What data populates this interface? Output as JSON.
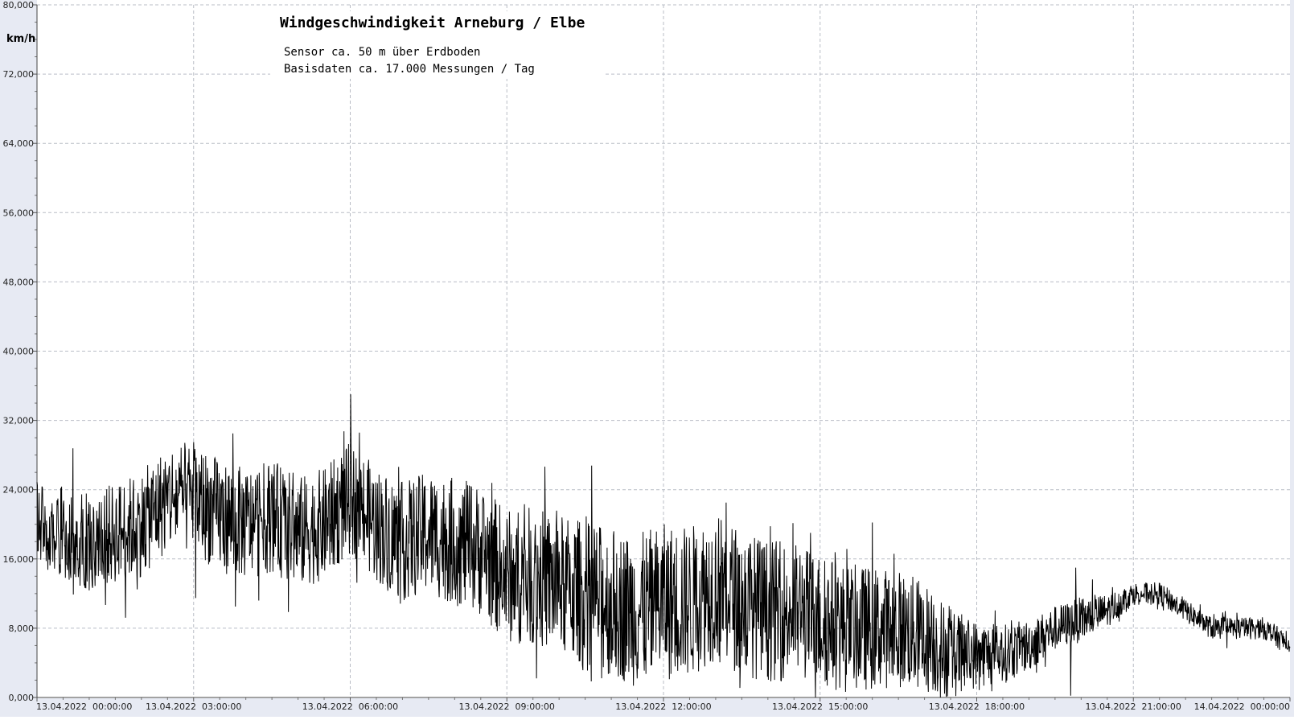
{
  "chart_data": {
    "type": "line",
    "title": "Windgeschwindigkeit  Arneburg / Elbe",
    "subtitle_lines": [
      "Sensor ca. 50 m über Erdboden",
      "Basisdaten ca. 17.000 Messungen / Tag"
    ],
    "ylabel": "km/h",
    "ylim": [
      0,
      80
    ],
    "yticks": [
      "0,000",
      "8,000",
      "16,000",
      "24,000",
      "32,000",
      "40,000",
      "48,000",
      "56,000",
      "64,000",
      "72,000",
      "80,000"
    ],
    "xlim_hours": [
      0,
      24
    ],
    "xticks": [
      {
        "hour": 0,
        "label": "13.04.2022  00:00:00"
      },
      {
        "hour": 3,
        "label": "13.04.2022  03:00:00"
      },
      {
        "hour": 6,
        "label": "13.04.2022  06:00:00"
      },
      {
        "hour": 9,
        "label": "13.04.2022  09:00:00"
      },
      {
        "hour": 12,
        "label": "13.04.2022  12:00:00"
      },
      {
        "hour": 15,
        "label": "13.04.2022  15:00:00"
      },
      {
        "hour": 18,
        "label": "13.04.2022  18:00:00"
      },
      {
        "hour": 21,
        "label": "13.04.2022  21:00:00"
      },
      {
        "hour": 24,
        "label": "14.04.2022  00:00:00"
      }
    ],
    "grid": true,
    "series": [
      {
        "color": "#000000",
        "mean_profile": {
          "hours": [
            0,
            0.5,
            1,
            1.5,
            2,
            2.5,
            3,
            3.5,
            4,
            4.5,
            5,
            5.5,
            6,
            6.5,
            7,
            7.5,
            8,
            8.5,
            9,
            9.5,
            10,
            10.5,
            11,
            11.5,
            12,
            12.5,
            13,
            13.5,
            14,
            14.5,
            15,
            15.5,
            16,
            16.5,
            17,
            17.5,
            18,
            18.5,
            19,
            19.5,
            20,
            20.5,
            21,
            21.5,
            22,
            22.5,
            23,
            23.5,
            24
          ],
          "values": [
            20,
            19,
            18,
            19,
            20,
            23,
            23,
            21,
            20,
            21,
            19,
            20,
            23,
            20,
            18,
            19,
            18,
            17,
            14,
            14,
            13,
            12,
            11,
            10,
            11,
            11,
            13,
            11,
            10,
            10,
            9,
            8,
            8,
            8,
            7,
            5,
            5,
            5,
            6,
            8,
            9,
            10,
            12,
            12,
            10,
            8,
            8,
            8,
            6
          ]
        },
        "spread_profile": {
          "hours": [
            0,
            3,
            6,
            9,
            12,
            15,
            17,
            18,
            19.5,
            20,
            21,
            24
          ],
          "values": [
            4,
            5,
            5,
            6,
            7,
            6,
            5,
            3,
            2,
            2,
            1,
            1
          ]
        },
        "peaks": [
          {
            "hour": 3.0,
            "value": 29.5
          },
          {
            "hour": 3.75,
            "value": 30.5
          },
          {
            "hour": 3.8,
            "value": 10.5
          },
          {
            "hour": 13.2,
            "value": 22.5
          },
          {
            "hour": 19.9,
            "value": 15.0
          },
          {
            "hour": 19.8,
            "value": 0.2
          }
        ]
      }
    ]
  }
}
